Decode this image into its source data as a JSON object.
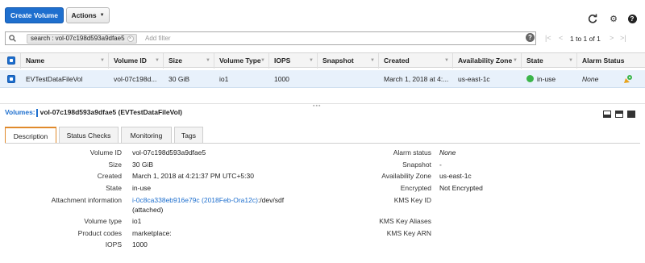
{
  "toolbar": {
    "create_label": "Create Volume",
    "actions_label": "Actions"
  },
  "icons": {
    "refresh": "refresh-icon",
    "settings": "gear-icon",
    "help": "help-icon"
  },
  "filter": {
    "token": "search : vol-07c198d593a9dfae5",
    "placeholder": "Add filter"
  },
  "pagination": {
    "text": "1 to 1 of 1"
  },
  "grid": {
    "columns": [
      "Name",
      "Volume ID",
      "Size",
      "Volume Type",
      "IOPS",
      "Snapshot",
      "Created",
      "Availability Zone",
      "State",
      "Alarm Status"
    ],
    "row": {
      "name": "EVTestDataFileVol",
      "volume_id": "vol-07c198d...",
      "size": "30 GiB",
      "volume_type": "io1",
      "iops": "1000",
      "snapshot": "",
      "created": "March 1, 2018 at 4:...",
      "availability_zone": "us-east-1c",
      "state": "in-use",
      "alarm_status": "None"
    }
  },
  "detail": {
    "title_label": "Volumes:",
    "title_value": "vol-07c198d593a9dfae5 (EVTestDataFileVol)",
    "tabs": [
      "Description",
      "Status Checks",
      "Monitoring",
      "Tags"
    ],
    "left": {
      "volume_id": {
        "label": "Volume ID",
        "value": "vol-07c198d593a9dfae5"
      },
      "size": {
        "label": "Size",
        "value": "30 GiB"
      },
      "created": {
        "label": "Created",
        "value": "March 1, 2018 at 4:21:37 PM UTC+5:30"
      },
      "state": {
        "label": "State",
        "value": "in-use"
      },
      "attachment": {
        "label": "Attachment information",
        "link": "i-0c8ca338eb916e79c (2018Feb-Ora12c)",
        "value": ":/dev/sdf",
        "value2": "(attached)"
      },
      "volume_type": {
        "label": "Volume type",
        "value": "io1"
      },
      "product_codes": {
        "label": "Product codes",
        "value": "marketplace:"
      },
      "iops": {
        "label": "IOPS",
        "value": "1000"
      }
    },
    "right": {
      "alarm_status": {
        "label": "Alarm status",
        "value": "None"
      },
      "snapshot": {
        "label": "Snapshot",
        "value": "-"
      },
      "availability_zone": {
        "label": "Availability Zone",
        "value": "us-east-1c"
      },
      "encrypted": {
        "label": "Encrypted",
        "value": "Not Encrypted"
      },
      "kms_key_id": {
        "label": "KMS Key ID",
        "value": ""
      },
      "kms_key_aliases": {
        "label": "KMS Key Aliases",
        "value": ""
      },
      "kms_key_arn": {
        "label": "KMS Key ARN",
        "value": ""
      }
    }
  },
  "colors": {
    "primary": "#1e6fce",
    "selected_row": "#e8f1fb",
    "tab_accent": "#e08a2c",
    "state_ok": "#3bb54a"
  }
}
